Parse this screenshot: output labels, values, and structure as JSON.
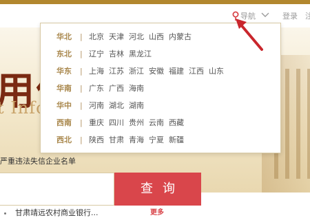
{
  "topnav": {
    "nav_label": "导航",
    "login_label": "登录",
    "register_label": "注"
  },
  "hero": {
    "title": "用信",
    "subtitle": "t Info"
  },
  "regions": [
    {
      "name": "华北",
      "cities": [
        "北京",
        "天津",
        "河北",
        "山西",
        "内蒙古"
      ]
    },
    {
      "name": "东北",
      "cities": [
        "辽宁",
        "吉林",
        "黑龙江"
      ]
    },
    {
      "name": "华东",
      "cities": [
        "上海",
        "江苏",
        "浙江",
        "安徽",
        "福建",
        "江西",
        "山东"
      ]
    },
    {
      "name": "华南",
      "cities": [
        "广东",
        "广西",
        "海南"
      ]
    },
    {
      "name": "华中",
      "cities": [
        "河南",
        "湖北",
        "湖南"
      ]
    },
    {
      "name": "西南",
      "cities": [
        "重庆",
        "四川",
        "贵州",
        "云南",
        "西藏"
      ]
    },
    {
      "name": "西北",
      "cities": [
        "陕西",
        "甘肃",
        "青海",
        "宁夏",
        "新疆"
      ]
    }
  ],
  "separator": "|",
  "notice": "严重违法失信企业名单",
  "search": {
    "button_label": "查询"
  },
  "result": {
    "text": "甘肃靖远农村商业银行...",
    "more_label": "更多"
  },
  "colors": {
    "accent_gold": "#b2872e",
    "region_label": "#a8864a",
    "search_button": "#d9464b",
    "annotation_arrow": "#c9262c"
  }
}
